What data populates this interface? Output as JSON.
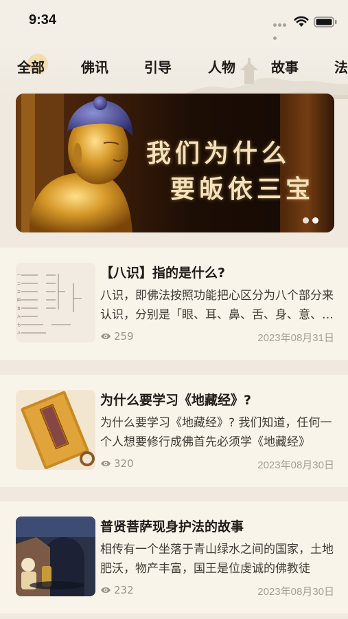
{
  "status": {
    "time": "9:34",
    "icons": [
      "signal-dots-icon",
      "wifi-icon",
      "battery-icon"
    ]
  },
  "tabs": [
    {
      "label": "全部",
      "active": true
    },
    {
      "label": "佛讯",
      "active": false
    },
    {
      "label": "引导",
      "active": false
    },
    {
      "label": "人物",
      "active": false
    },
    {
      "label": "故事",
      "active": false
    },
    {
      "label": "法",
      "active": false
    }
  ],
  "banner": {
    "line1": "我们为什么",
    "line2": "要皈依三宝",
    "pages": 2,
    "current_page": 2
  },
  "articles": [
    {
      "title": "【八识】指的是什么?",
      "desc": "八识，即佛法按照功能把心区分为八个部分来认识，分别是「眼、耳、鼻、舌、身、意、末那、阿赖耶」",
      "views": "259",
      "date": "2023年08月31日",
      "thumb": "diagram"
    },
    {
      "title": "为什么要学习《地藏经》?",
      "desc": "为什么要学习《地藏经》? 我们知道，任何一个人想要修行成佛首先必须学《地藏经》",
      "views": "320",
      "date": "2023年08月30日",
      "thumb": "sutra-book"
    },
    {
      "title": "普贤菩萨现身护法的故事",
      "desc": "相传有一个坐落于青山绿水之间的国家，土地肥沃，物产丰富，国王是位虔诚的佛教徒",
      "views": "232",
      "date": "2023年08月30日",
      "thumb": "story-scene"
    }
  ],
  "colors": {
    "page_bg": "#efe9df",
    "card_bg": "#f9f4ea",
    "tab_highlight": "#f2cf86",
    "banner_text": "#f3e2bd",
    "meta_gray": "#9b948c"
  }
}
